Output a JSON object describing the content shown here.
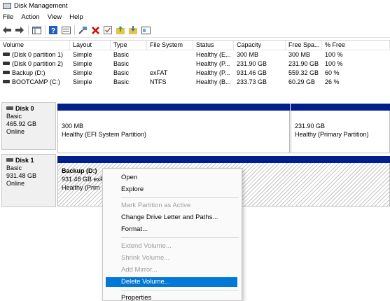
{
  "window": {
    "title": "Disk Management"
  },
  "menu": [
    "File",
    "Action",
    "View",
    "Help"
  ],
  "toolbar": {
    "icons": [
      "back-arrow-icon",
      "forward-arrow-icon",
      "console-tree-icon",
      "help-icon",
      "properties-icon",
      "connect-icon",
      "delete-icon",
      "check-icon",
      "import-icon",
      "export-icon",
      "show-icon"
    ],
    "delete_color": "#d40000"
  },
  "volumes": {
    "headers": [
      "Volume",
      "Layout",
      "Type",
      "File System",
      "Status",
      "Capacity",
      "Free Spa...",
      "% Free"
    ],
    "rows": [
      [
        "(Disk 0 partition 1)",
        "Simple",
        "Basic",
        "",
        "Healthy (E...",
        "300 MB",
        "300 MB",
        "100 %"
      ],
      [
        "(Disk 0 partition 2)",
        "Simple",
        "Basic",
        "",
        "Healthy (P...",
        "231.90 GB",
        "231.90 GB",
        "100 %"
      ],
      [
        "Backup  (D:)",
        "Simple",
        "Basic",
        "exFAT",
        "Healthy (P...",
        "931.46 GB",
        "559.32 GB",
        "60 %"
      ],
      [
        "BOOTCAMP (C:)",
        "Simple",
        "Basic",
        "NTFS",
        "Healthy (B...",
        "233.73 GB",
        "60.29 GB",
        "26 %"
      ]
    ]
  },
  "disks": [
    {
      "name": "Disk 0",
      "type": "Basic",
      "size": "465.92 GB",
      "state": "Online",
      "partitions": [
        {
          "size": "300 MB",
          "status": "Healthy (EFI System Partition)"
        },
        {
          "size": "231.90 GB",
          "status": "Healthy (Primary Partition)"
        }
      ]
    },
    {
      "name": "Disk 1",
      "type": "Basic",
      "size": "931.48 GB",
      "state": "Online",
      "partitions": [
        {
          "title": "Backup  (D:)",
          "size": "931.48 GB exF",
          "status": "Healthy (Prim"
        }
      ]
    }
  ],
  "context_menu": {
    "items": [
      {
        "label": "Open",
        "enabled": true
      },
      {
        "label": "Explore",
        "enabled": true
      },
      {
        "label": "Mark Partition as Active",
        "enabled": false
      },
      {
        "label": "Change Drive Letter and Paths...",
        "enabled": true
      },
      {
        "label": "Format...",
        "enabled": true
      },
      {
        "label": "Extend Volume...",
        "enabled": false
      },
      {
        "label": "Shrink Volume...",
        "enabled": false
      },
      {
        "label": "Add Mirror...",
        "enabled": false
      },
      {
        "label": "Delete Volume...",
        "enabled": true,
        "highlighted": true
      },
      {
        "label": "Properties",
        "enabled": true
      }
    ],
    "highlight_color": "#0078d7"
  },
  "colors": {
    "partition_bar": "#001f8c"
  }
}
